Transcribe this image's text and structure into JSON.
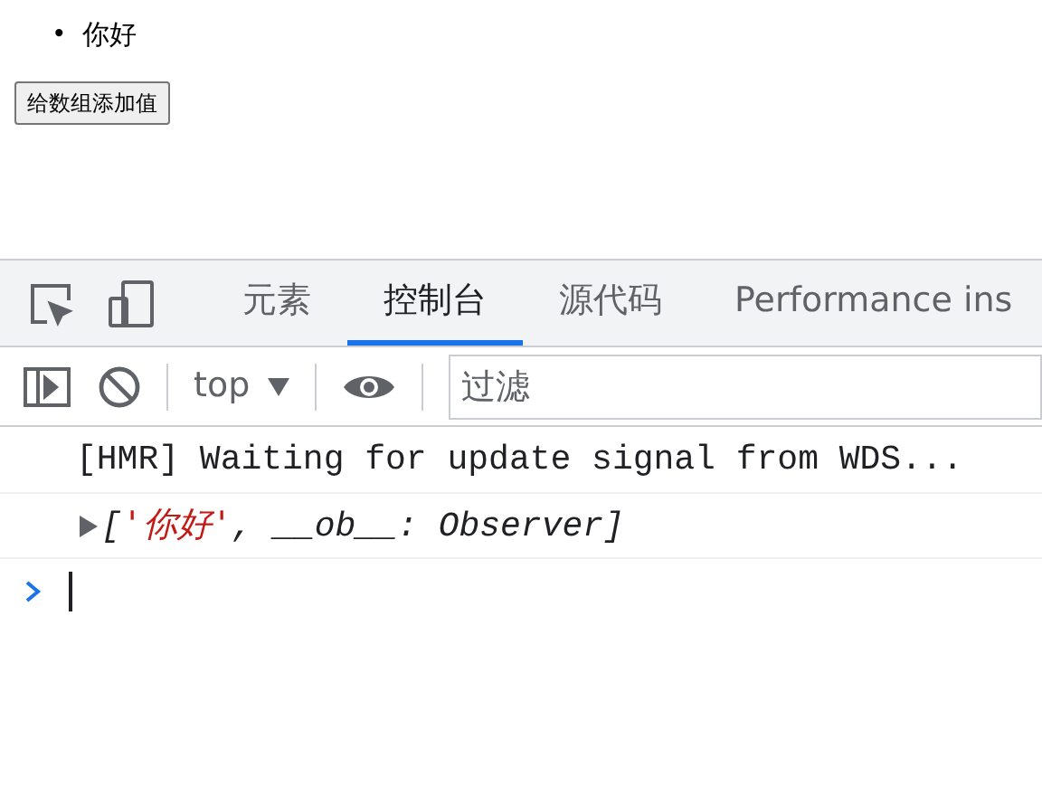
{
  "page": {
    "list_items": [
      {
        "marker": "•",
        "text": "你好"
      }
    ],
    "button": "给数组添加值"
  },
  "devtools": {
    "tabs": [
      {
        "label": "元素",
        "selected": false
      },
      {
        "label": "控制台",
        "selected": true
      },
      {
        "label": "源代码",
        "selected": false
      },
      {
        "label": "Performance ins",
        "selected": false
      }
    ],
    "toolbar": {
      "context": "top",
      "filter": {
        "placeholder": "过滤"
      }
    },
    "messages": [
      {
        "kind": "log",
        "text": "[HMR] Waiting for update signal from WDS..."
      },
      {
        "kind": "object",
        "expanded": false,
        "parts": [
          {
            "kind": "plain",
            "text": "["
          },
          {
            "kind": "string",
            "text": "'你好'"
          },
          {
            "kind": "plain",
            "text": ", __ob__: Observer]"
          }
        ]
      }
    ]
  }
}
